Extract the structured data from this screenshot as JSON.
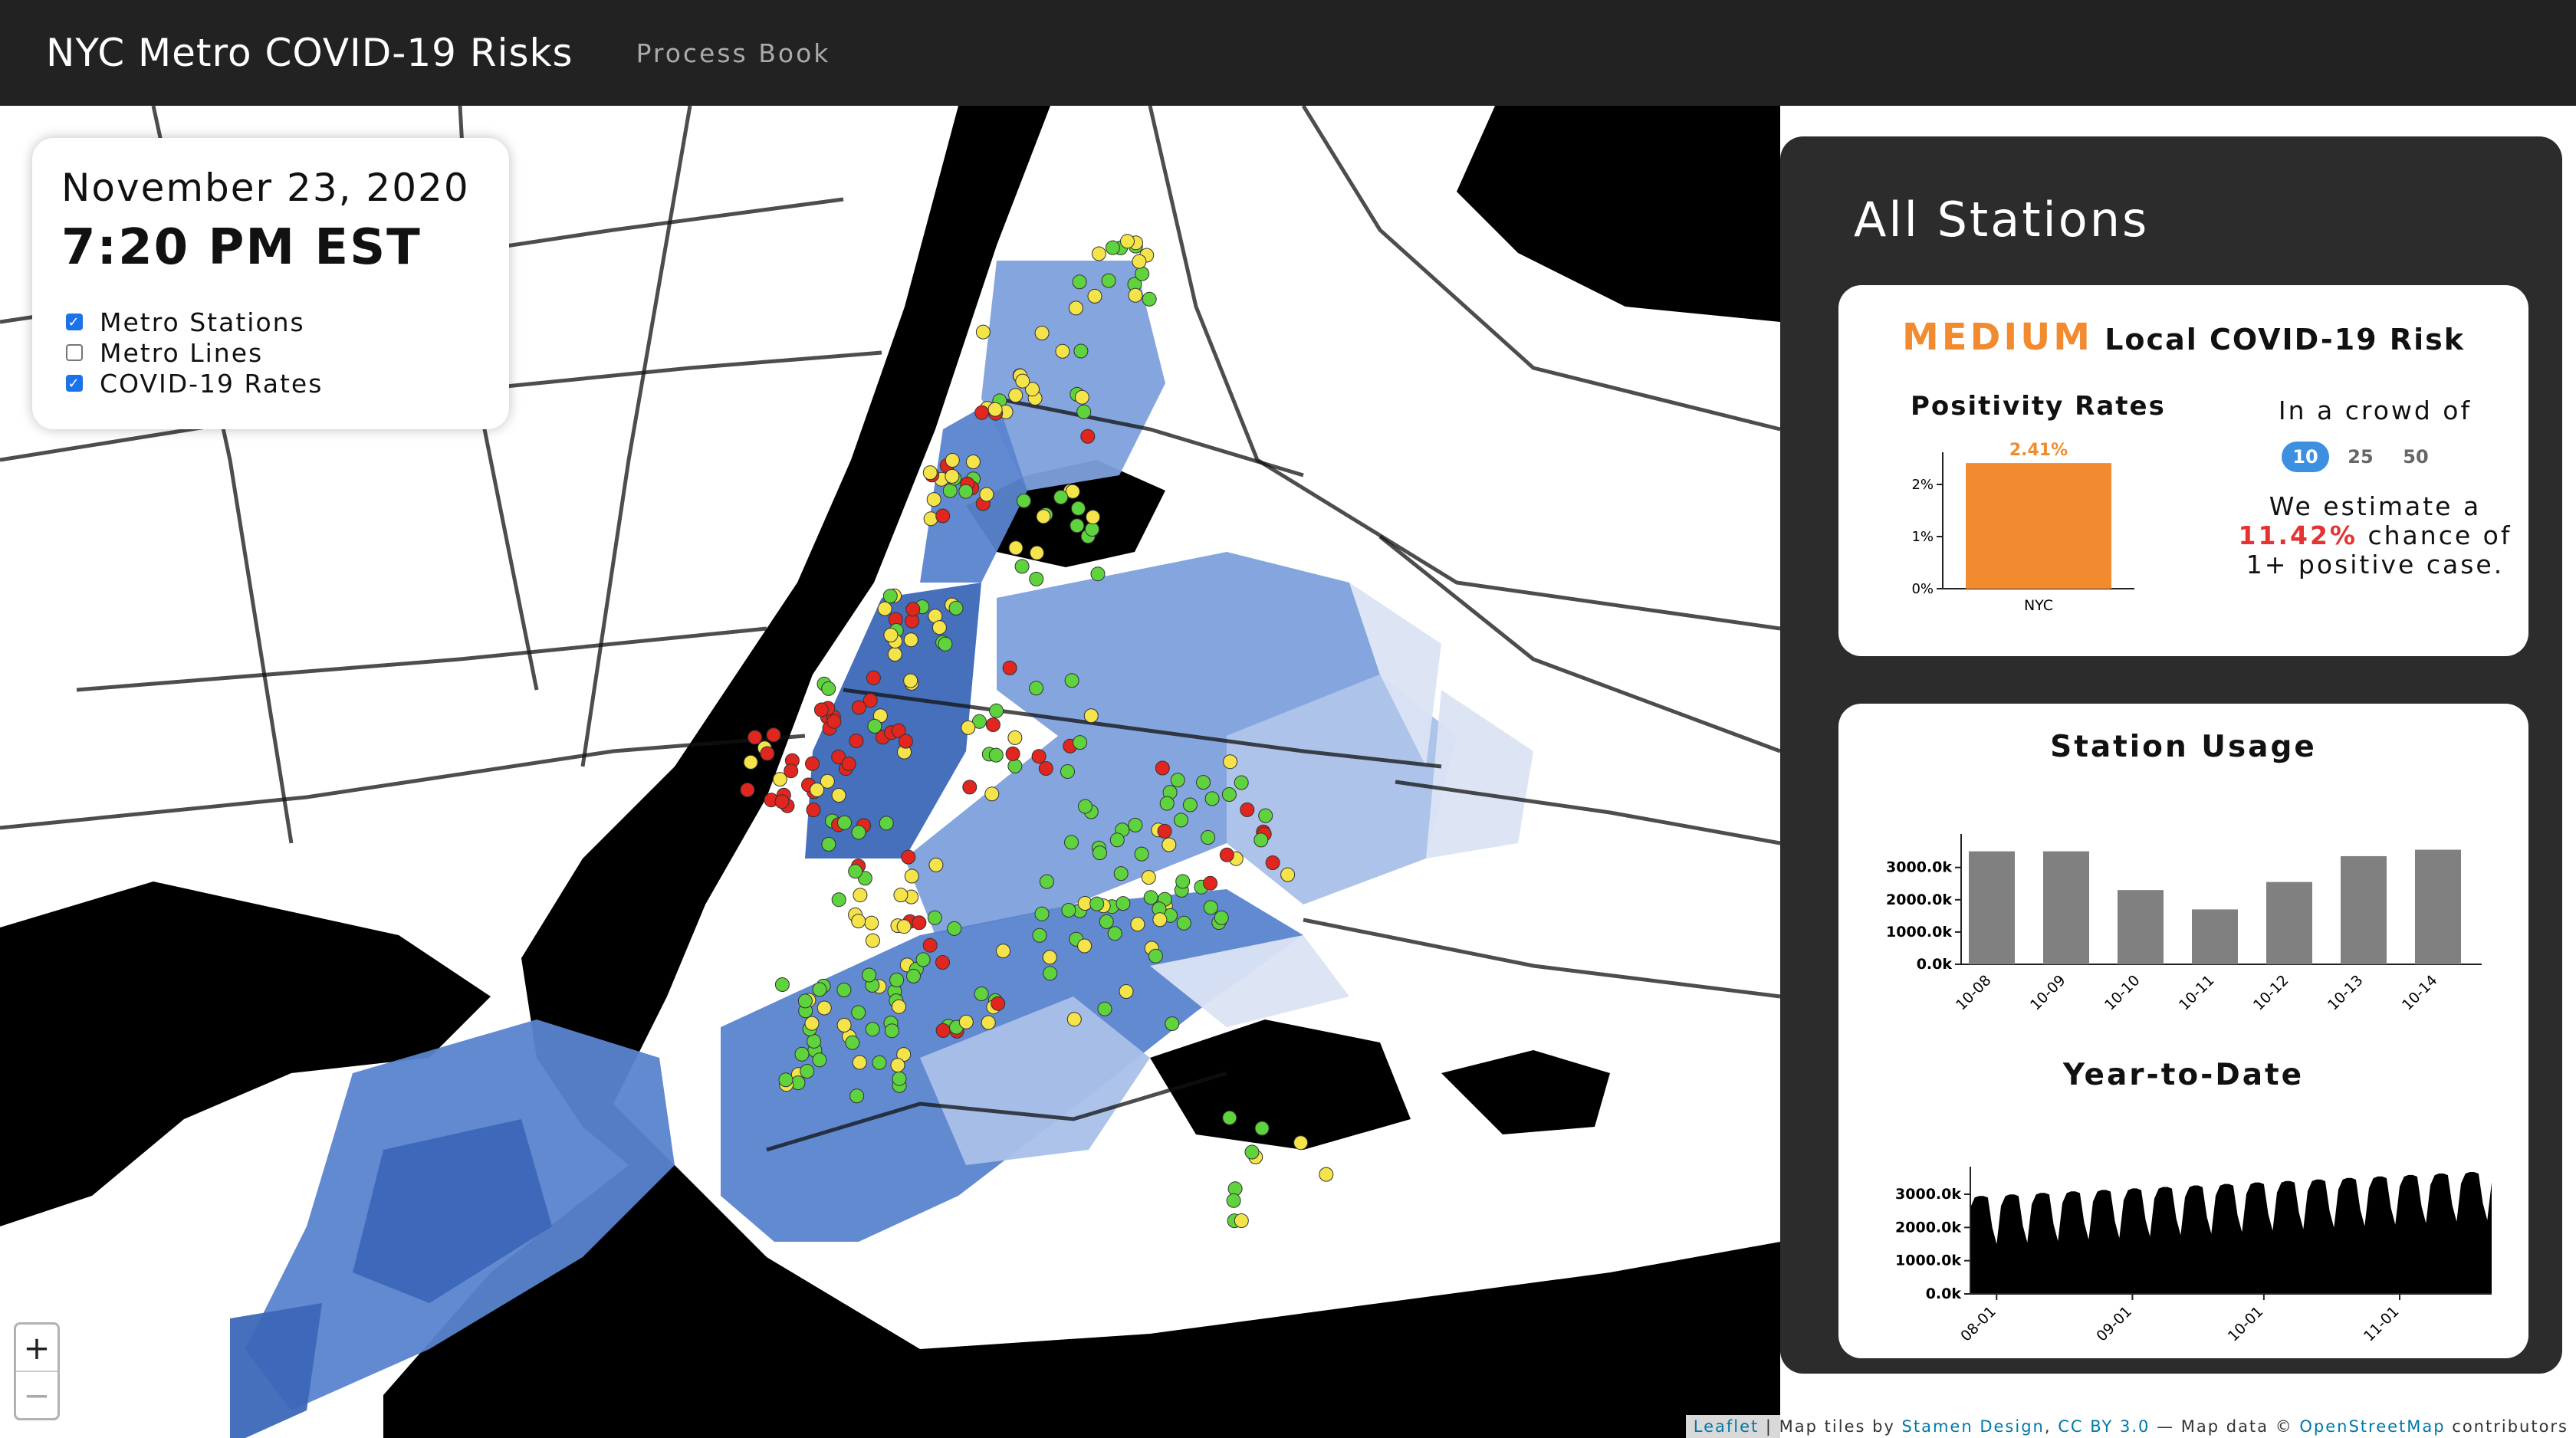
{
  "header": {
    "title": "NYC Metro COVID-19 Risks",
    "nav_link": "Process Book"
  },
  "controls": {
    "date": "November 23, 2020",
    "time": "7:20 PM EST",
    "layers": [
      {
        "label": "Metro Stations",
        "checked": true
      },
      {
        "label": "Metro Lines",
        "checked": false
      },
      {
        "label": "COVID-19 Rates",
        "checked": true
      }
    ]
  },
  "zoom": {
    "in": "+",
    "out": "−"
  },
  "attribution": {
    "leaflet": "Leaflet",
    "sep1": " | Map tiles by ",
    "stamen": "Stamen Design",
    "sep2": ", ",
    "cc": "CC BY 3.0",
    "sep3": " — Map data © ",
    "osm": "OpenStreetMap",
    "tail": " contributors"
  },
  "panel": {
    "title": "All Stations",
    "risk": {
      "level": "MEDIUM",
      "suffix": "Local COVID-19 Risk",
      "level_color": "#f28b30",
      "positivity_title": "Positivity Rates",
      "crowd_label": "In a crowd of",
      "crowd_options": [
        "10",
        "25",
        "50"
      ],
      "selected_crowd": "10",
      "estimate_before": "We estimate a",
      "estimate_pct": "11.42%",
      "estimate_after": "chance of 1+ positive case."
    },
    "usage": {
      "title": "Station Usage"
    },
    "ytd": {
      "title": "Year-to-Date"
    }
  },
  "chart_data": [
    {
      "type": "bar",
      "title": "Positivity Rates",
      "categories": [
        "NYC"
      ],
      "values": [
        2.41
      ],
      "data_labels": [
        "2.41%"
      ],
      "yticks": [
        "0%",
        "1%",
        "2%"
      ],
      "ylim": [
        0,
        2.5
      ],
      "bar_color": "#f28b30"
    },
    {
      "type": "bar",
      "title": "Station Usage",
      "categories": [
        "10-08",
        "10-09",
        "10-10",
        "10-11",
        "10-12",
        "10-13",
        "10-14"
      ],
      "values": [
        3500,
        3500,
        2300,
        1700,
        2550,
        3350,
        3550
      ],
      "yticks": [
        "0.0k",
        "1000.0k",
        "2000.0k",
        "3000.0k"
      ],
      "ylim": [
        0,
        3800
      ],
      "bar_color": "#808080"
    },
    {
      "type": "area",
      "title": "Year-to-Date",
      "xticks": [
        "08-01",
        "09-01",
        "10-01",
        "11-01"
      ],
      "yticks": [
        "0.0k",
        "1000.0k",
        "2000.0k",
        "3000.0k"
      ],
      "ylim": [
        0,
        3600
      ],
      "x_range": [
        "07-26",
        "11-22"
      ],
      "weekly_pattern": [
        2600,
        2900,
        2950,
        2950,
        2900,
        2000,
        1500
      ],
      "weeks": 17,
      "growth_per_week": 45,
      "fill_color": "#000000"
    }
  ],
  "map": {
    "land_color": "#ffffff",
    "water_color": "#000000",
    "choropleth_colors": [
      "#dbe4f4",
      "#a9c0e8",
      "#7da0dc",
      "#5a84cf",
      "#3c67b8"
    ],
    "station_colors": {
      "high": "#e0261e",
      "medium": "#f5e34a",
      "low": "#5fd33d"
    }
  }
}
